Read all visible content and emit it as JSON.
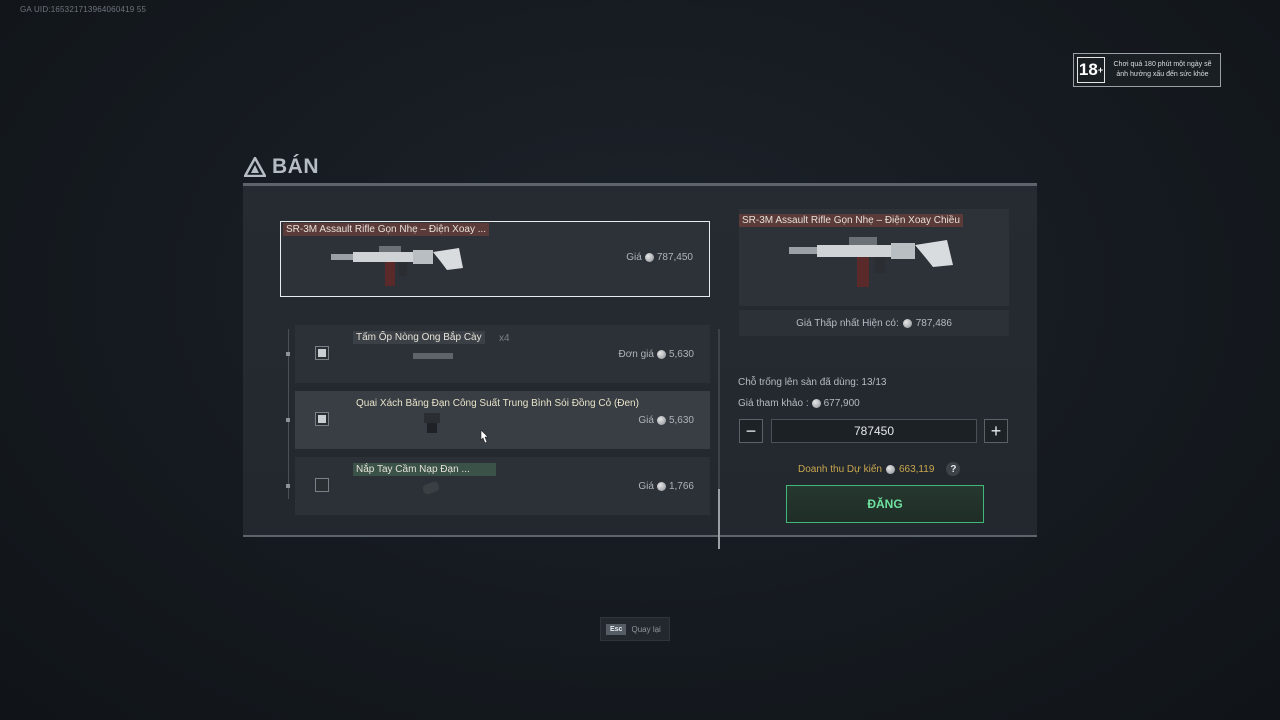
{
  "meta": {
    "uid": "GA UID:165321713964060419 55"
  },
  "age_badge": {
    "rating": "18",
    "rating_sup": "+",
    "notice": "Chơi quá 180 phút một ngày sẽ ảnh hưởng xấu đến sức khỏe"
  },
  "panel": {
    "title": "BÁN"
  },
  "selected_item": {
    "name": "SR-3M Assault Rifle Gọn Nhẹ – Điện Xoay ...",
    "price_label": "Giá",
    "price": "787,450"
  },
  "sub_items": [
    {
      "name": "Tấm Ốp Nòng Ong Bắp Cày",
      "qty": "x4",
      "price_label": "Đơn giá",
      "price": "5,630",
      "checked": true
    },
    {
      "name": "Quai Xách Băng Đạn Công Suất Trung Bình Sói Đồng Cỏ (Đen)",
      "qty": "",
      "price_label": "Giá",
      "price": "5,630",
      "checked": true
    },
    {
      "name": "Nắp Tay Cầm Nạp Đạn ...",
      "qty": "",
      "price_label": "Giá",
      "price": "1,766",
      "checked": false
    }
  ],
  "detail": {
    "name": "SR-3M Assault Rifle Gọn Nhẹ – Điện Xoay Chiều",
    "min_price_label": "Giá Thấp nhất Hiện có:",
    "min_price": "787,486",
    "slots_label": "Chỗ trống lên sàn đã dùng: 13/13",
    "ref_label": "Giá tham khảo :",
    "ref_price": "677,900",
    "minus": "−",
    "plus": "+",
    "input_value": "787450",
    "revenue_label": "Doanh thu Dự kiến",
    "revenue": "663,119",
    "help": "?",
    "submit_label": "ĐĂNG"
  },
  "footer": {
    "esc_key": "Esc",
    "esc_label": "Quay lại"
  },
  "colors": {
    "accent_green": "#3fb87a",
    "revenue_gold": "#c9a74e"
  }
}
